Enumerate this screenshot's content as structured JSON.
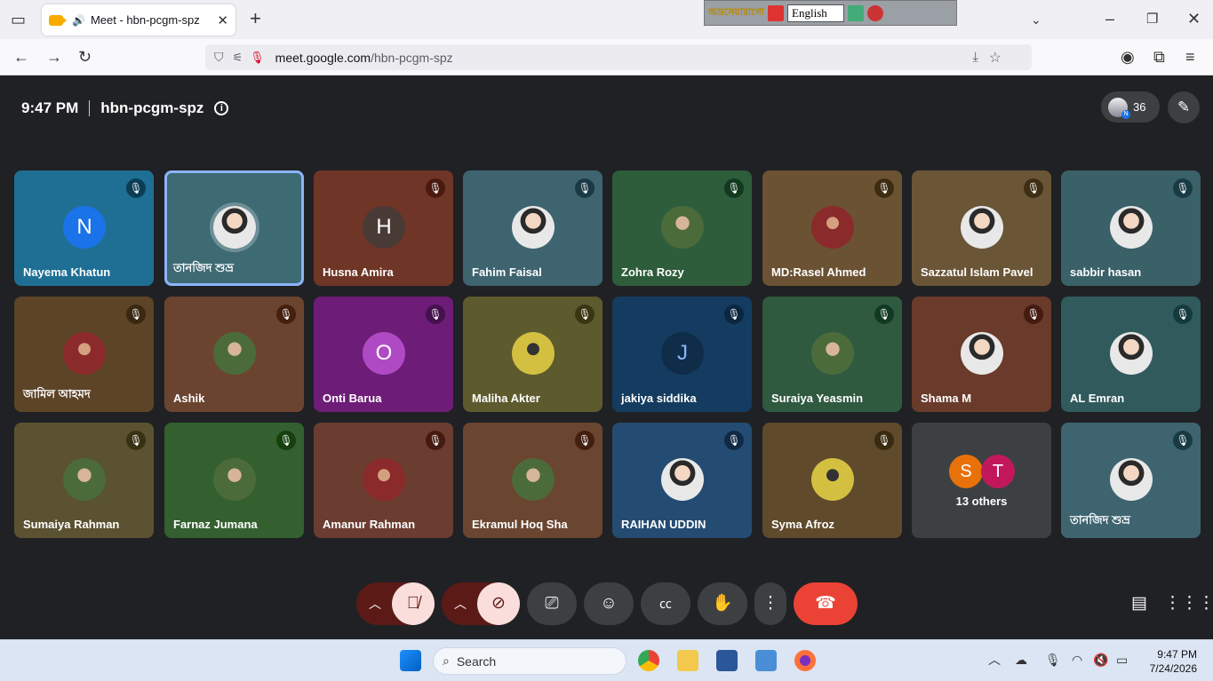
{
  "browser": {
    "tab_title": "Meet - hbn-pcgm-spz",
    "url_domain": "meet.google.com",
    "url_path": "/hbn-pcgm-spz",
    "ime_brand": "অভ্রসেয়ারাগো",
    "ime_language": "English"
  },
  "meeting": {
    "time": "9:47 PM",
    "code": "hbn-pcgm-spz",
    "participant_count": "36"
  },
  "tiles": [
    {
      "name": "Nayema Khatun",
      "initial": "N",
      "bg": "#1f6f95",
      "avatar_bg": "#1a73e8",
      "mic": "#0b3d55"
    },
    {
      "name": "তানজিদ শুভ্র",
      "initial": "",
      "bg": "#3e6a74",
      "avatar_bg": "photo",
      "mic": "",
      "selected": true
    },
    {
      "name": "Husna Amira",
      "initial": "H",
      "bg": "#6f3526",
      "avatar_bg": "#4a3a36",
      "mic": "#4a1a10"
    },
    {
      "name": "Fahim Faisal",
      "initial": "",
      "bg": "#3e6470",
      "avatar_bg": "photo",
      "mic": "#1b3a46"
    },
    {
      "name": "Zohra Rozy",
      "initial": "",
      "bg": "#2e5d3b",
      "avatar_bg": "photo-g",
      "mic": "#123a1f"
    },
    {
      "name": "MD:Rasel Ahmed",
      "initial": "",
      "bg": "#6b5233",
      "avatar_bg": "photo-r",
      "mic": "#3d2c12"
    },
    {
      "name": "Sazzatul Islam Pavel",
      "initial": "",
      "bg": "#6b5537",
      "avatar_bg": "photo",
      "mic": "#3e2e15"
    },
    {
      "name": "sabbir hasan",
      "initial": "",
      "bg": "#3a6068",
      "avatar_bg": "photo",
      "mic": "#193b44"
    },
    {
      "name": "জামিল আহমদ",
      "initial": "",
      "bg": "#5d4427",
      "avatar_bg": "photo-r",
      "mic": "#3a2810"
    },
    {
      "name": "Ashik",
      "initial": "",
      "bg": "#6b4430",
      "avatar_bg": "photo-g",
      "mic": "#45200f"
    },
    {
      "name": "Onti Barua",
      "initial": "O",
      "bg": "#6d1d78",
      "avatar_bg": "#b04ac4",
      "mic": "#46104f"
    },
    {
      "name": "Maliha Akter",
      "initial": "",
      "bg": "#5d5a2e",
      "avatar_bg": "photo-y",
      "mic": "#3a3612"
    },
    {
      "name": "jakiya siddika",
      "initial": "J",
      "bg": "#143c60",
      "avatar_bg": "#0f2c48",
      "mic": "#0b2740",
      "initial_color": "#8ab4f8"
    },
    {
      "name": "Suraiya Yeasmin",
      "initial": "",
      "bg": "#2f5a40",
      "avatar_bg": "photo-g",
      "mic": "#123a22"
    },
    {
      "name": "Shama M",
      "initial": "",
      "bg": "#6a3a2b",
      "avatar_bg": "photo",
      "mic": "#451a10"
    },
    {
      "name": "AL Emran",
      "initial": "",
      "bg": "#315a5c",
      "avatar_bg": "photo",
      "mic": "#143a3d"
    },
    {
      "name": "Sumaiya Rahman",
      "initial": "",
      "bg": "#5a5230",
      "avatar_bg": "photo-g",
      "mic": "#383212"
    },
    {
      "name": "Farnaz Jumana",
      "initial": "",
      "bg": "#33602e",
      "avatar_bg": "photo-g",
      "mic": "#17400f"
    },
    {
      "name": "Amanur Rahman",
      "initial": "",
      "bg": "#6b3d30",
      "avatar_bg": "photo-r",
      "mic": "#451a10"
    },
    {
      "name": "Ekramul Hoq Sha",
      "initial": "",
      "bg": "#6a4530",
      "avatar_bg": "photo-g",
      "mic": "#431f10"
    },
    {
      "name": "RAIHAN UDDIN",
      "initial": "",
      "bg": "#244c72",
      "avatar_bg": "photo",
      "mic": "#102a45"
    },
    {
      "name": "Syma Afroz",
      "initial": "",
      "bg": "#5f4a2b",
      "avatar_bg": "photo-y",
      "mic": "#3a2a10"
    },
    {
      "name": "13 others",
      "initial": "",
      "bg": "#3c4043",
      "avatar_bg": "",
      "mic": "",
      "others": [
        "S",
        "T"
      ]
    },
    {
      "name": "তানজিদ শুভ্র",
      "initial": "",
      "bg": "#3e6470",
      "avatar_bg": "photo",
      "mic": "#193b44"
    }
  ],
  "others_colors": [
    "#e8710a",
    "#c2185b"
  ],
  "controls": {
    "mic_label": "mic-off",
    "cam_label": "camera-off",
    "end_color": "#ea4335"
  },
  "taskbar": {
    "search_placeholder": "Search",
    "time": "9:47 PM",
    "date": "7/24/2026"
  }
}
